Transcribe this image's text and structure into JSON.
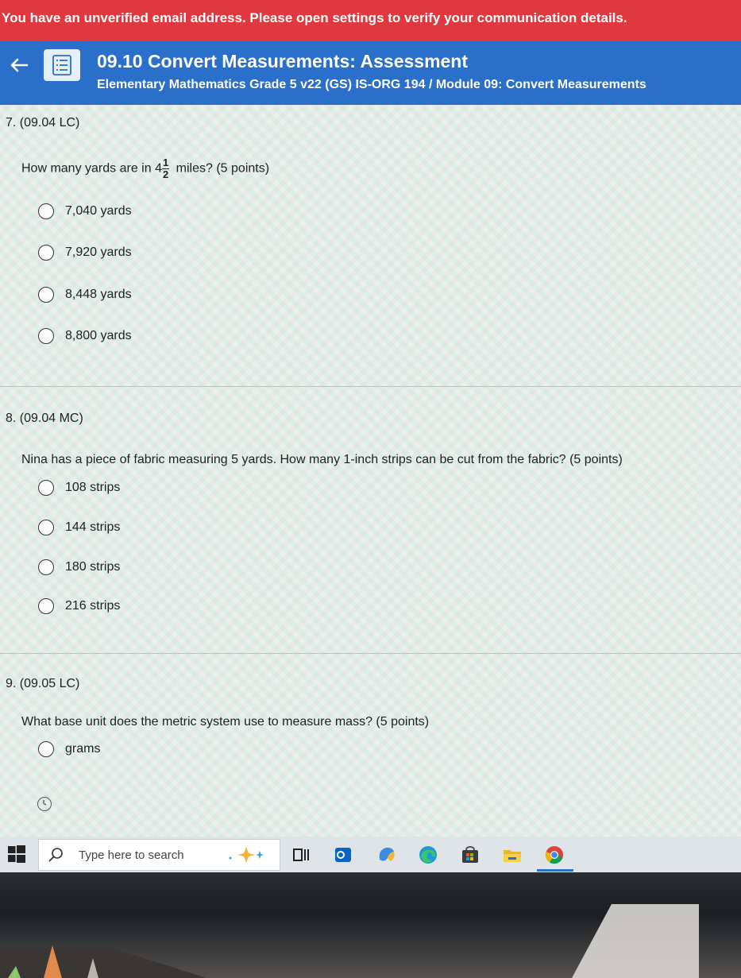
{
  "alert": {
    "text": "You have an unverified email address. Please open settings to verify your communication details."
  },
  "header": {
    "title": "09.10 Convert Measurements: Assessment",
    "subtitle": "Elementary Mathematics Grade 5 v22 (GS) IS-ORG 194 / Module 09: Convert Measurements"
  },
  "questions": [
    {
      "number": "7. (09.04 LC)",
      "text_before": "How many yards are in",
      "mixed_whole": "4",
      "mixed_num": "1",
      "mixed_den": "2",
      "text_after": "miles? (5 points)",
      "options": [
        "7,040 yards",
        "7,920 yards",
        "8,448 yards",
        "8,800 yards"
      ]
    },
    {
      "number": "8. (09.04 MC)",
      "text": "Nina has a piece of fabric measuring 5 yards. How many 1-inch strips can be cut from the fabric? (5 points)",
      "options": [
        "108 strips",
        "144 strips",
        "180 strips",
        "216 strips"
      ]
    },
    {
      "number": "9. (09.05 LC)",
      "text": "What base unit does the metric system use to measure mass? (5 points)",
      "options": [
        "grams"
      ]
    }
  ],
  "taskbar": {
    "search_placeholder": "Type here to search",
    "apps": [
      "task-view-icon",
      "outlook-icon",
      "teams-icon",
      "edge-icon",
      "store-icon",
      "file-explorer-icon",
      "chrome-icon"
    ]
  },
  "colors": {
    "alert_bg": "#e0383f",
    "header_bg": "#2a6fc9",
    "page_bg": "#e9f1ec"
  }
}
